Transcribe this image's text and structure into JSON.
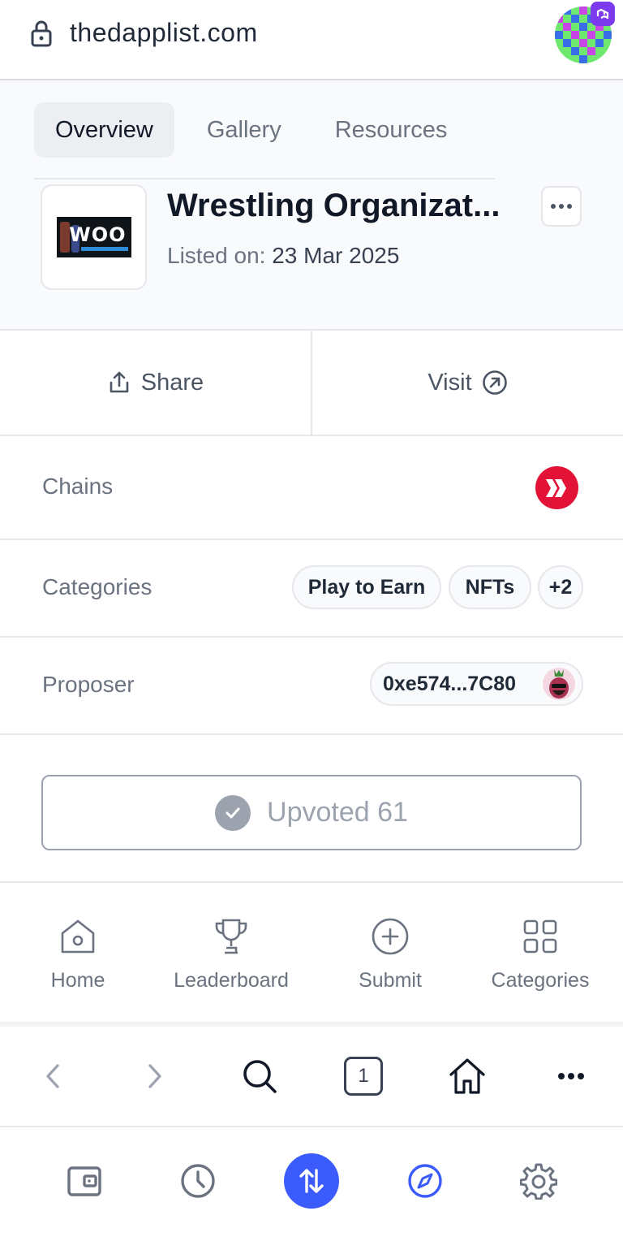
{
  "browser": {
    "url": "thedapplist.com",
    "tab_count": "1"
  },
  "tabs": [
    {
      "label": "Overview",
      "active": true
    },
    {
      "label": "Gallery",
      "active": false
    },
    {
      "label": "Resources",
      "active": false
    }
  ],
  "dapp": {
    "title": "Wrestling Organizat...",
    "listed_label": "Listed on:",
    "listed_date": "23 Mar 2025",
    "logo_text": "WOO"
  },
  "actions": {
    "share_label": "Share",
    "visit_label": "Visit"
  },
  "rows": {
    "chains_label": "Chains",
    "chain_icon": "hive-icon",
    "categories_label": "Categories",
    "categories": [
      "Play to Earn",
      "NFTs",
      "+2"
    ],
    "proposer_label": "Proposer",
    "proposer_address": "0xe574...7C80"
  },
  "upvote": {
    "label": "Upvoted 61"
  },
  "site_nav": [
    {
      "label": "Home",
      "icon": "home-icon"
    },
    {
      "label": "Leaderboard",
      "icon": "trophy-icon"
    },
    {
      "label": "Submit",
      "icon": "plus-circle-icon"
    },
    {
      "label": "Categories",
      "icon": "grid-icon"
    }
  ],
  "colors": {
    "accent": "#3b5bfd",
    "chain_red": "#e31337",
    "text_muted": "#6b7280"
  }
}
